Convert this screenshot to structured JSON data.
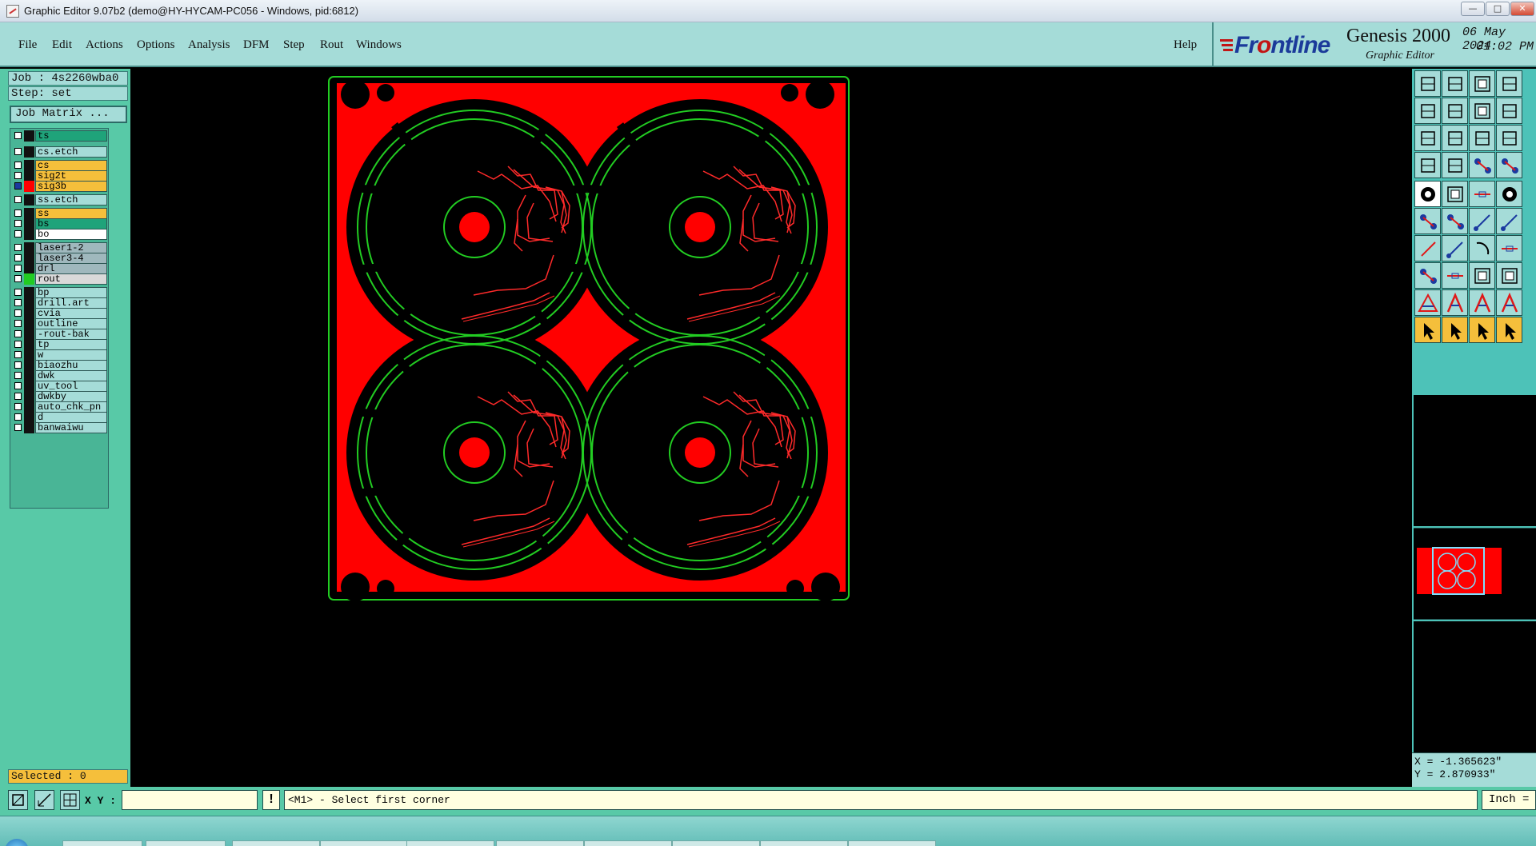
{
  "window": {
    "title": "Graphic Editor 9.07b2 (demo@HY-HYCAM-PC056 - Windows, pid:6812)",
    "controls": {
      "minimize": "—",
      "maximize": "□",
      "close": "✕"
    }
  },
  "menu": {
    "items": [
      {
        "label": "File",
        "icon": ""
      },
      {
        "label": "Edit",
        "icon": ""
      },
      {
        "label": "Actions",
        "icon": ""
      },
      {
        "label": "Options",
        "icon": ""
      },
      {
        "label": "Analysis",
        "icon": ""
      },
      {
        "label": "DFM",
        "icon": ""
      },
      {
        "label": "Step",
        "icon": ""
      },
      {
        "label": "Rout",
        "icon": ""
      },
      {
        "label": "Windows",
        "icon": ""
      }
    ],
    "help": "Help"
  },
  "brand": {
    "logo_pre": "Fr",
    "logo_o": "o",
    "logo_post": "ntline",
    "product": "Genesis 2000",
    "subtitle": "Graphic Editor",
    "date": "06 May 2024",
    "time": "01:02 PM"
  },
  "job": {
    "job_line": "Job : 4s2260wba0",
    "step_line": "Step: set",
    "matrix_button": "Job Matrix ..."
  },
  "layers": [
    {
      "name": "ts",
      "color": "#1fa37a",
      "swatch": "#111111",
      "checked": false
    },
    {
      "name": "cs.etch",
      "color": "#a5dcd8",
      "swatch": "#111111",
      "checked": false
    },
    {
      "name": "cs",
      "color": "#f5bf3b",
      "swatch": "#111111",
      "checked": false
    },
    {
      "name": "sig2t",
      "color": "#f5bf3b",
      "swatch": "#111111",
      "checked": false
    },
    {
      "name": "sig3b",
      "color": "#f5bf3b",
      "swatch": "#ff0000",
      "checked": true
    },
    {
      "name": "ss.etch",
      "color": "#a5dcd8",
      "swatch": "#111111",
      "checked": false
    },
    {
      "name": "ss",
      "color": "#f5bf3b",
      "swatch": "#111111",
      "checked": false
    },
    {
      "name": "bs",
      "color": "#1fa37a",
      "swatch": "#111111",
      "checked": false
    },
    {
      "name": "bo",
      "color": "#ffffff",
      "swatch": "#111111",
      "checked": false
    },
    {
      "name": "laser1-2",
      "color": "#9fb8bd",
      "swatch": "#111111",
      "checked": false
    },
    {
      "name": "laser3-4",
      "color": "#9fb8bd",
      "swatch": "#111111",
      "checked": false
    },
    {
      "name": "drl",
      "color": "#9fb8bd",
      "swatch": "#111111",
      "checked": false
    },
    {
      "name": "rout",
      "color": "#d9d9d9",
      "swatch": "#22cc22",
      "checked": false
    },
    {
      "name": "bp",
      "color": "#a5dcd8",
      "swatch": "#111111",
      "checked": false
    },
    {
      "name": "drill.art",
      "color": "#a5dcd8",
      "swatch": "#111111",
      "checked": false
    },
    {
      "name": "cvia",
      "color": "#a5dcd8",
      "swatch": "#111111",
      "checked": false
    },
    {
      "name": "outline",
      "color": "#a5dcd8",
      "swatch": "#111111",
      "checked": false
    },
    {
      "name": "-rout-bak",
      "color": "#a5dcd8",
      "swatch": "#111111",
      "checked": false
    },
    {
      "name": "tp",
      "color": "#a5dcd8",
      "swatch": "#111111",
      "checked": false
    },
    {
      "name": "w",
      "color": "#a5dcd8",
      "swatch": "#111111",
      "checked": false
    },
    {
      "name": "biaozhu",
      "color": "#a5dcd8",
      "swatch": "#111111",
      "checked": false
    },
    {
      "name": "dwk",
      "color": "#a5dcd8",
      "swatch": "#111111",
      "checked": false
    },
    {
      "name": "uv_tool",
      "color": "#a5dcd8",
      "swatch": "#111111",
      "checked": false
    },
    {
      "name": "dwkby",
      "color": "#a5dcd8",
      "swatch": "#111111",
      "checked": false
    },
    {
      "name": "auto_chk_pn",
      "color": "#a5dcd8",
      "swatch": "#111111",
      "checked": false
    },
    {
      "name": "d",
      "color": "#a5dcd8",
      "swatch": "#111111",
      "checked": false
    },
    {
      "name": "banwaiwu",
      "color": "#a5dcd8",
      "swatch": "#111111",
      "checked": false
    }
  ],
  "selected": "Selected : 0",
  "canvas": {
    "copper_color": "#ff0000",
    "rout_color": "#22cc22",
    "background": "#000000"
  },
  "tools": [
    "move-to-layer-icon",
    "copy-to-layer-icon",
    "home-icon",
    "panel-icon",
    "move-left-icon",
    "move-right-icon",
    "flip-icon",
    "step-icon",
    "zoom-fit-icon",
    "zoom-center-icon",
    "zoom-1to1-icon",
    "help-icon",
    "measure-icon",
    "snap-grid-icon",
    "snap-pad-icon",
    "snap-pin-icon",
    "pad-shape-icon",
    "polygon-icon",
    "line-pattern-icon",
    "circle-pad-icon",
    "connect-points-icon",
    "intersect-icon",
    "line-node-icon",
    "line-node-alt-icon",
    "draw-line-icon",
    "draw-line-alt-icon",
    "arc-icon",
    "split-icon",
    "pad-node-icon",
    "dash-icon",
    "dimension-icon",
    "group-icon",
    "triangle-icon",
    "text-a-icon",
    "text-a-alt-icon",
    "text-a-alt2-icon",
    "select-arrow-icon",
    "select-box-icon",
    "select-poly-icon",
    "select-net-icon"
  ],
  "coords": {
    "x": "X = -1.365623\"",
    "y": "Y = 2.870933\""
  },
  "statusbar": {
    "xy_label": "X Y :",
    "xy_value": "",
    "bang": "!",
    "prompt": "<M1> - Select first corner",
    "unit": "Inch"
  }
}
